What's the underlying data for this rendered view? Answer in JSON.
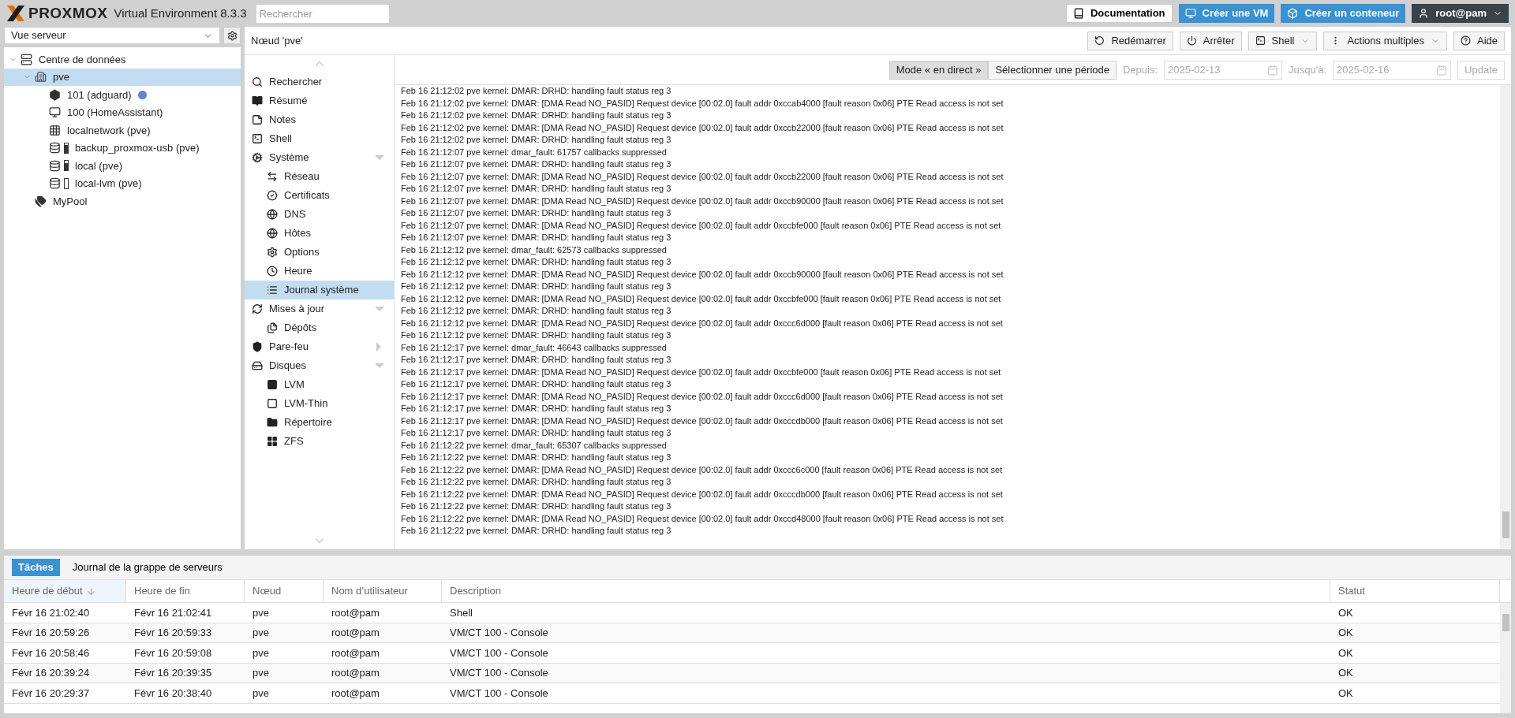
{
  "header": {
    "logo": "PROXMOX",
    "product": "Virtual Environment 8.3.3",
    "search_placeholder": "Rechercher"
  },
  "top_buttons": [
    {
      "label": "Documentation",
      "kind": "doc"
    },
    {
      "label": "Créer une VM",
      "kind": "vm"
    },
    {
      "label": "Créer un conteneur",
      "kind": "ct"
    },
    {
      "label": "root@pam",
      "kind": "user"
    }
  ],
  "resource_view": {
    "value": "Vue serveur"
  },
  "tree": [
    {
      "label": "Centre de données",
      "kind": "datacenter",
      "expanded": true,
      "selected": false,
      "children": [
        {
          "label": "pve",
          "kind": "node",
          "expanded": true,
          "selected": true,
          "children": [
            {
              "label": "101 (adguard)",
              "kind": "container",
              "selected": false,
              "color": "#6b7fd7"
            },
            {
              "label": "100 (HomeAssistant)",
              "kind": "vm",
              "selected": false
            },
            {
              "label": "localnetwork (pve)",
              "kind": "network",
              "selected": false
            },
            {
              "label": "backup_proxmox-usb (pve)",
              "kind": "storage",
              "selected": false
            },
            {
              "label": "local (pve)",
              "kind": "storage",
              "selected": false
            },
            {
              "label": "local-lvm (pve)",
              "kind": "storage_empty",
              "selected": false
            }
          ]
        },
        {
          "label": "MyPool",
          "kind": "pool",
          "selected": false
        }
      ]
    }
  ],
  "main": {
    "title": "Nœud 'pve'",
    "actions": [
      {
        "label": "Redémarrer",
        "kind": "restart"
      },
      {
        "label": "Arrêter",
        "kind": "power"
      },
      {
        "label": "Shell",
        "kind": "shell"
      },
      {
        "label": "Actions multiples",
        "kind": "multi"
      },
      {
        "label": "Aide",
        "kind": "help"
      }
    ]
  },
  "nav": [
    {
      "label": "Rechercher",
      "selected": false
    },
    {
      "label": "Résumé",
      "selected": false
    },
    {
      "label": "Notes",
      "selected": false
    },
    {
      "label": "Shell",
      "selected": false
    },
    {
      "label": "Système",
      "selected": false,
      "expanded": true,
      "children": [
        {
          "label": "Réseau",
          "selected": false
        },
        {
          "label": "Certificats",
          "selected": false
        },
        {
          "label": "DNS",
          "selected": false
        },
        {
          "label": "Hôtes",
          "selected": false
        },
        {
          "label": "Options",
          "selected": false
        },
        {
          "label": "Heure",
          "selected": false
        },
        {
          "label": "Journal système",
          "selected": true
        }
      ]
    },
    {
      "label": "Mises à jour",
      "selected": false,
      "expanded": true,
      "children": [
        {
          "label": "Dépôts",
          "selected": false
        }
      ]
    },
    {
      "label": "Pare-feu",
      "selected": false,
      "expanded": false
    },
    {
      "label": "Disques",
      "selected": false,
      "expanded": true,
      "children": [
        {
          "label": "LVM",
          "selected": false
        },
        {
          "label": "LVM-Thin",
          "selected": false
        },
        {
          "label": "Répertoire",
          "selected": false
        },
        {
          "label": "ZFS",
          "selected": false
        }
      ]
    }
  ],
  "log": {
    "modes": [
      {
        "label": "Mode « en direct »",
        "selected": true
      },
      {
        "label": "Sélectionner une période",
        "selected": false
      }
    ],
    "from_label": "Depuis:",
    "from_value": "2025-02-13",
    "to_label": "Jusqu'à:",
    "to_value": "2025-02-16",
    "update": "Update",
    "range_disabled": true,
    "lines": [
      "Feb 16 21:12:02 pve kernel: DMAR: DRHD: handling fault status reg 3",
      "Feb 16 21:12:02 pve kernel: DMAR: [DMA Read NO_PASID] Request device [00:02.0] fault addr 0xccab4000 [fault reason 0x06] PTE Read access is not set",
      "Feb 16 21:12:02 pve kernel: DMAR: DRHD: handling fault status reg 3",
      "Feb 16 21:12:02 pve kernel: DMAR: [DMA Read NO_PASID] Request device [00:02.0] fault addr 0xccb22000 [fault reason 0x06] PTE Read access is not set",
      "Feb 16 21:12:02 pve kernel: DMAR: DRHD: handling fault status reg 3",
      "Feb 16 21:12:07 pve kernel: dmar_fault: 61757 callbacks suppressed",
      "Feb 16 21:12:07 pve kernel: DMAR: DRHD: handling fault status reg 3",
      "Feb 16 21:12:07 pve kernel: DMAR: [DMA Read NO_PASID] Request device [00:02.0] fault addr 0xccb22000 [fault reason 0x06] PTE Read access is not set",
      "Feb 16 21:12:07 pve kernel: DMAR: DRHD: handling fault status reg 3",
      "Feb 16 21:12:07 pve kernel: DMAR: [DMA Read NO_PASID] Request device [00:02.0] fault addr 0xccb90000 [fault reason 0x06] PTE Read access is not set",
      "Feb 16 21:12:07 pve kernel: DMAR: DRHD: handling fault status reg 3",
      "Feb 16 21:12:07 pve kernel: DMAR: [DMA Read NO_PASID] Request device [00:02.0] fault addr 0xccbfe000 [fault reason 0x06] PTE Read access is not set",
      "Feb 16 21:12:07 pve kernel: DMAR: DRHD: handling fault status reg 3",
      "Feb 16 21:12:12 pve kernel: dmar_fault: 62573 callbacks suppressed",
      "Feb 16 21:12:12 pve kernel: DMAR: DRHD: handling fault status reg 3",
      "Feb 16 21:12:12 pve kernel: DMAR: [DMA Read NO_PASID] Request device [00:02.0] fault addr 0xccb90000 [fault reason 0x06] PTE Read access is not set",
      "Feb 16 21:12:12 pve kernel: DMAR: DRHD: handling fault status reg 3",
      "Feb 16 21:12:12 pve kernel: DMAR: [DMA Read NO_PASID] Request device [00:02.0] fault addr 0xccbfe000 [fault reason 0x06] PTE Read access is not set",
      "Feb 16 21:12:12 pve kernel: DMAR: DRHD: handling fault status reg 3",
      "Feb 16 21:12:12 pve kernel: DMAR: [DMA Read NO_PASID] Request device [00:02.0] fault addr 0xccc6d000 [fault reason 0x06] PTE Read access is not set",
      "Feb 16 21:12:12 pve kernel: DMAR: DRHD: handling fault status reg 3",
      "Feb 16 21:12:17 pve kernel: dmar_fault: 46643 callbacks suppressed",
      "Feb 16 21:12:17 pve kernel: DMAR: DRHD: handling fault status reg 3",
      "Feb 16 21:12:17 pve kernel: DMAR: [DMA Read NO_PASID] Request device [00:02.0] fault addr 0xccbfe000 [fault reason 0x06] PTE Read access is not set",
      "Feb 16 21:12:17 pve kernel: DMAR: DRHD: handling fault status reg 3",
      "Feb 16 21:12:17 pve kernel: DMAR: [DMA Read NO_PASID] Request device [00:02.0] fault addr 0xccc6d000 [fault reason 0x06] PTE Read access is not set",
      "Feb 16 21:12:17 pve kernel: DMAR: DRHD: handling fault status reg 3",
      "Feb 16 21:12:17 pve kernel: DMAR: [DMA Read NO_PASID] Request device [00:02.0] fault addr 0xcccdb000 [fault reason 0x06] PTE Read access is not set",
      "Feb 16 21:12:17 pve kernel: DMAR: DRHD: handling fault status reg 3",
      "Feb 16 21:12:22 pve kernel: dmar_fault: 65307 callbacks suppressed",
      "Feb 16 21:12:22 pve kernel: DMAR: DRHD: handling fault status reg 3",
      "Feb 16 21:12:22 pve kernel: DMAR: [DMA Read NO_PASID] Request device [00:02.0] fault addr 0xccc6c000 [fault reason 0x06] PTE Read access is not set",
      "Feb 16 21:12:22 pve kernel: DMAR: DRHD: handling fault status reg 3",
      "Feb 16 21:12:22 pve kernel: DMAR: [DMA Read NO_PASID] Request device [00:02.0] fault addr 0xcccdb000 [fault reason 0x06] PTE Read access is not set",
      "Feb 16 21:12:22 pve kernel: DMAR: DRHD: handling fault status reg 3",
      "Feb 16 21:12:22 pve kernel: DMAR: [DMA Read NO_PASID] Request device [00:02.0] fault addr 0xccd48000 [fault reason 0x06] PTE Read access is not set",
      "Feb 16 21:12:22 pve kernel: DMAR: DRHD: handling fault status reg 3"
    ]
  },
  "tasks": {
    "tabs": [
      {
        "label": "Tâches",
        "selected": true
      },
      {
        "label": "Journal de la grappe de serveurs",
        "selected": false
      }
    ],
    "columns": [
      {
        "label": "Heure de début",
        "sorted": true
      },
      {
        "label": "Heure de fin",
        "sorted": false
      },
      {
        "label": "Nœud",
        "sorted": false
      },
      {
        "label": "Nom d’utilisateur",
        "sorted": false
      },
      {
        "label": "Description",
        "sorted": false
      },
      {
        "label": "Statut",
        "sorted": false
      }
    ],
    "rows": [
      {
        "cells": [
          "Févr 16 21:02:40",
          "Févr 16 21:02:41",
          "pve",
          "root@pam",
          "Shell",
          "OK"
        ]
      },
      {
        "cells": [
          "Févr 16 20:59:26",
          "Févr 16 20:59:33",
          "pve",
          "root@pam",
          "VM/CT 100 - Console",
          "OK"
        ]
      },
      {
        "cells": [
          "Févr 16 20:58:46",
          "Févr 16 20:59:08",
          "pve",
          "root@pam",
          "VM/CT 100 - Console",
          "OK"
        ]
      },
      {
        "cells": [
          "Févr 16 20:39:24",
          "Févr 16 20:39:35",
          "pve",
          "root@pam",
          "VM/CT 100 - Console",
          "OK"
        ]
      },
      {
        "cells": [
          "Févr 16 20:29:37",
          "Févr 16 20:38:40",
          "pve",
          "root@pam",
          "VM/CT 100 - Console",
          "OK"
        ]
      }
    ]
  }
}
